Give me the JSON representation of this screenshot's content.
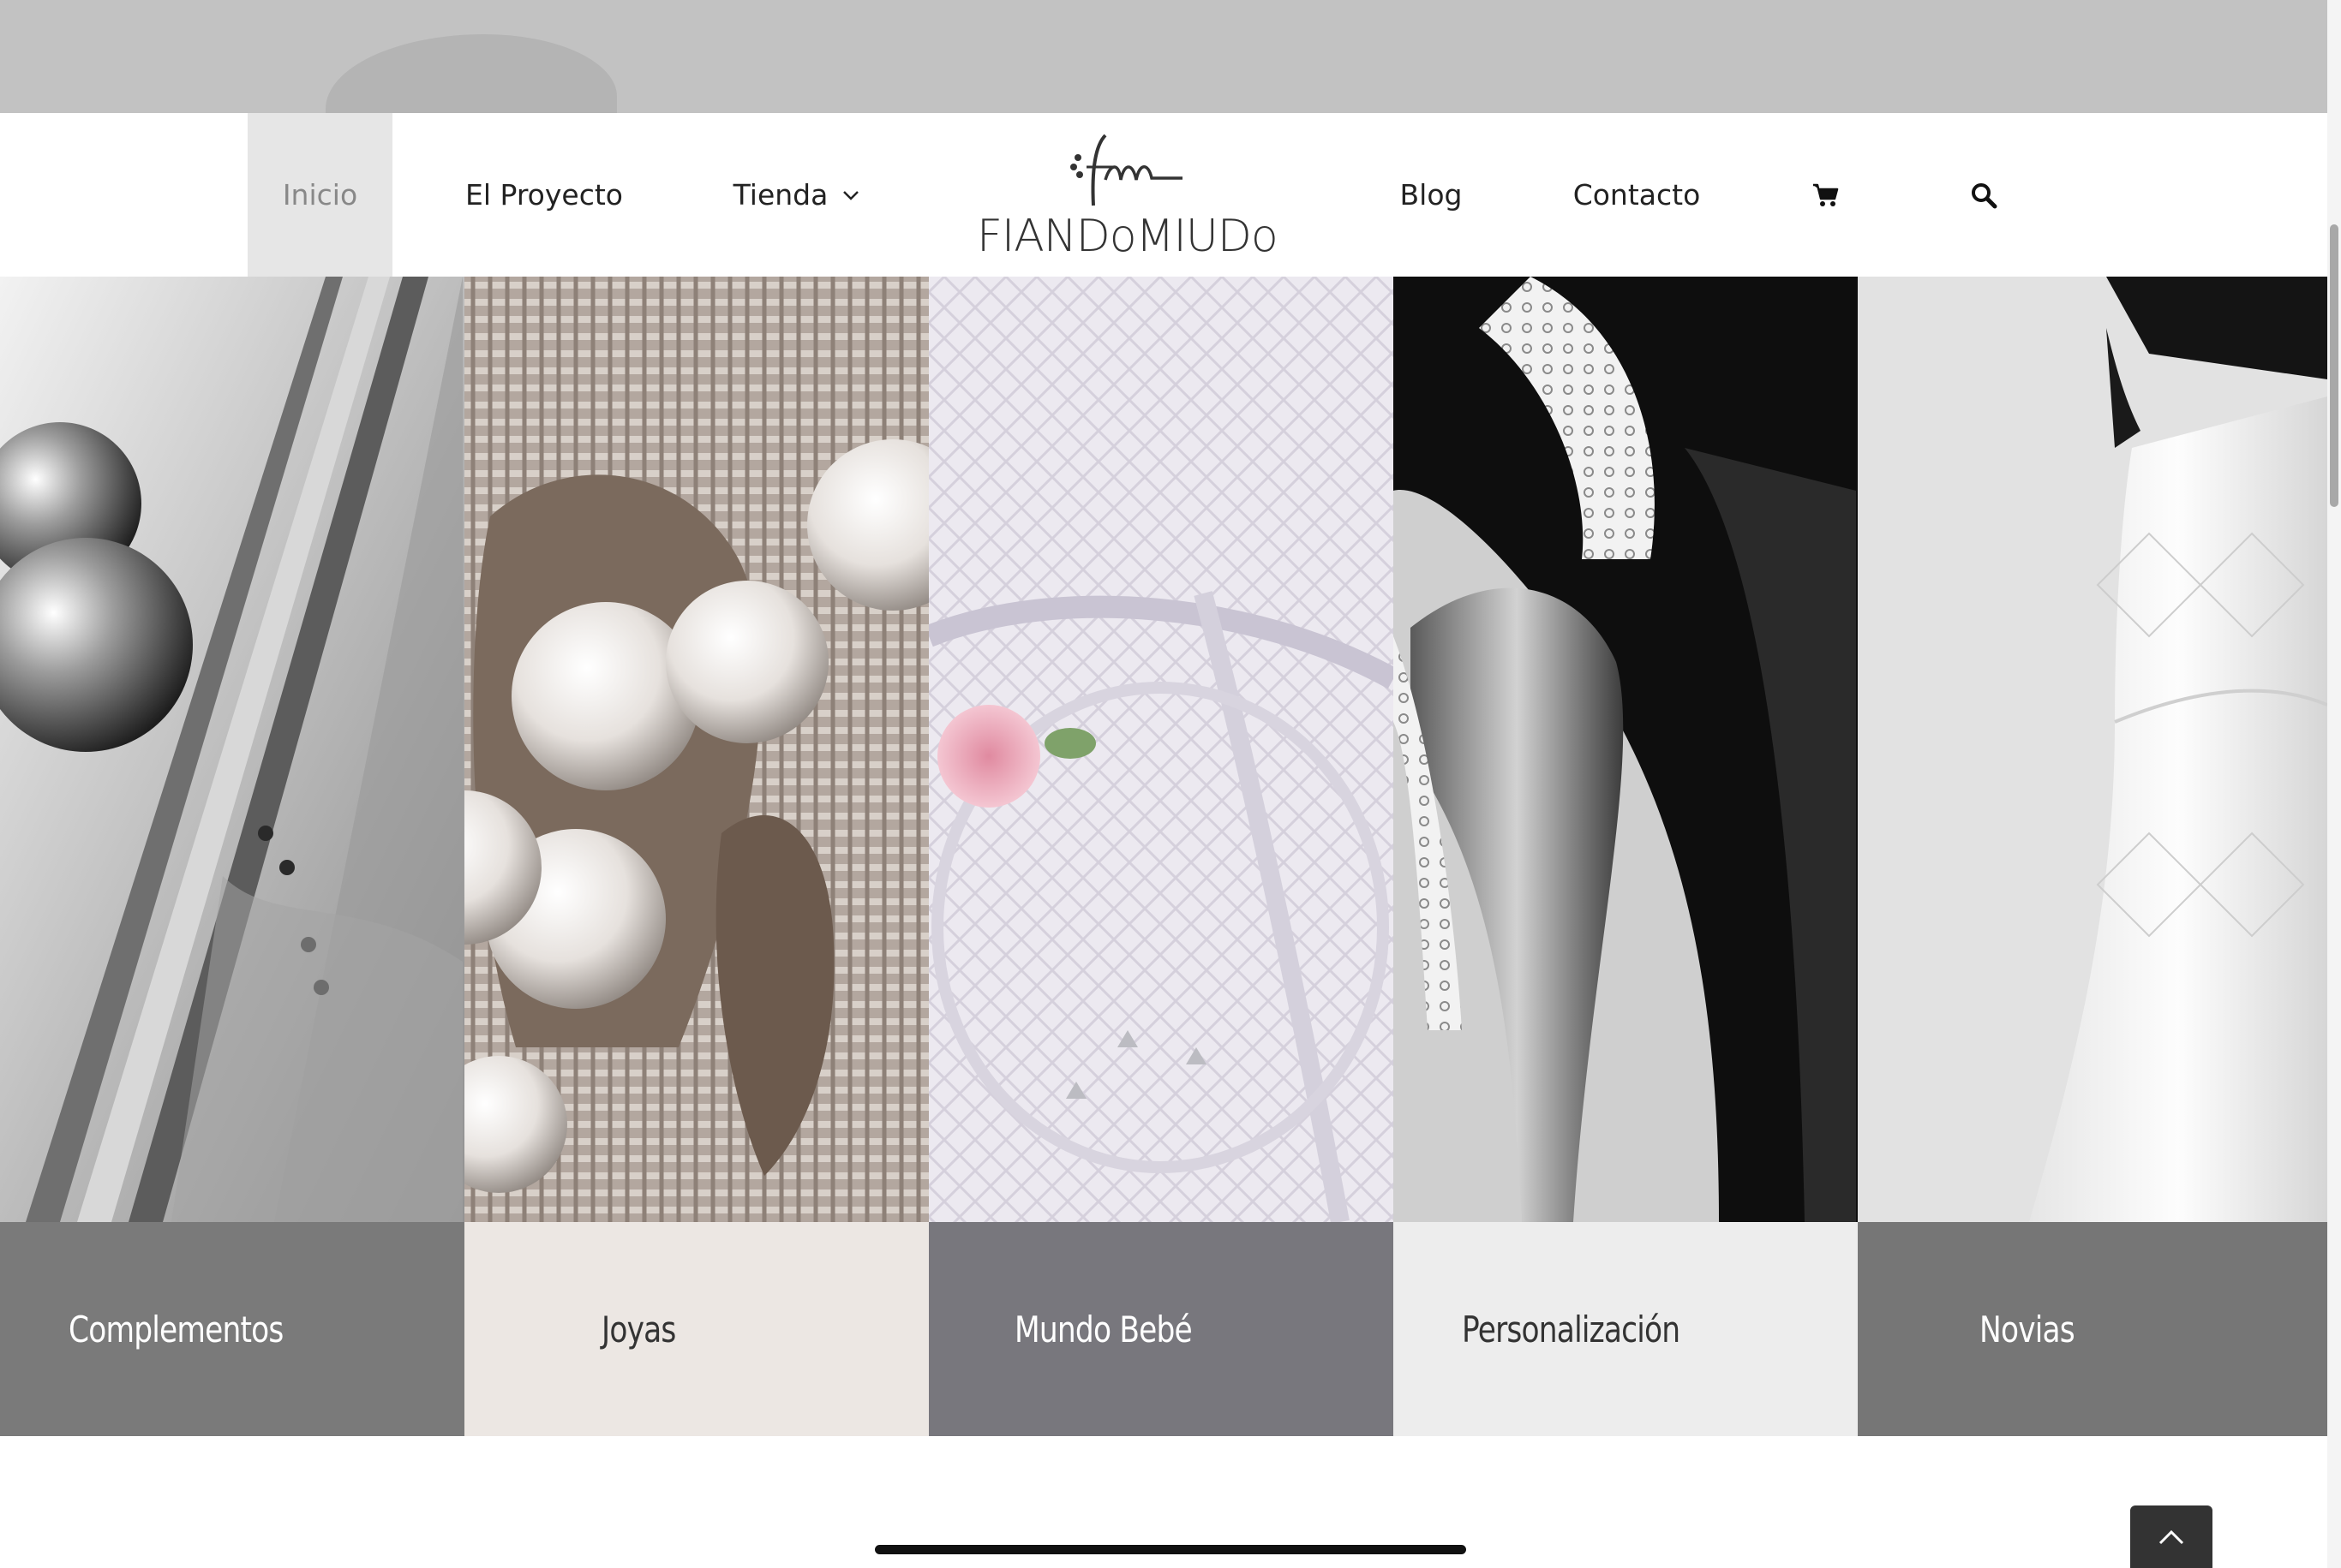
{
  "nav": {
    "items": [
      {
        "label": "Inicio",
        "active": true
      },
      {
        "label": "El Proyecto"
      },
      {
        "label": "Tienda",
        "has_dropdown": true
      },
      {
        "label": "Blog"
      },
      {
        "label": "Contacto"
      }
    ],
    "cart_icon": "shopping-cart-icon",
    "search_icon": "search-icon"
  },
  "logo": {
    "text": "FIANDoMIUDo",
    "monogram": "fm"
  },
  "categories": [
    {
      "label": "Complementos",
      "caption_color": "#ffffff",
      "caption_bg": "#7a7a7a"
    },
    {
      "label": "Joyas",
      "caption_color": "#333333",
      "caption_bg": "#ece7e3"
    },
    {
      "label": "Mundo Bebé",
      "caption_color": "#ffffff",
      "caption_bg": "#78777d"
    },
    {
      "label": "Personalización",
      "caption_color": "#333333",
      "caption_bg": "#ededed"
    },
    {
      "label": "Novias",
      "caption_color": "#ffffff",
      "caption_bg": "#767676"
    }
  ],
  "colors": {
    "active_nav_bg": "#e6e6e6",
    "nav_text": "#222222"
  },
  "to_top_icon": "chevron-up-icon"
}
